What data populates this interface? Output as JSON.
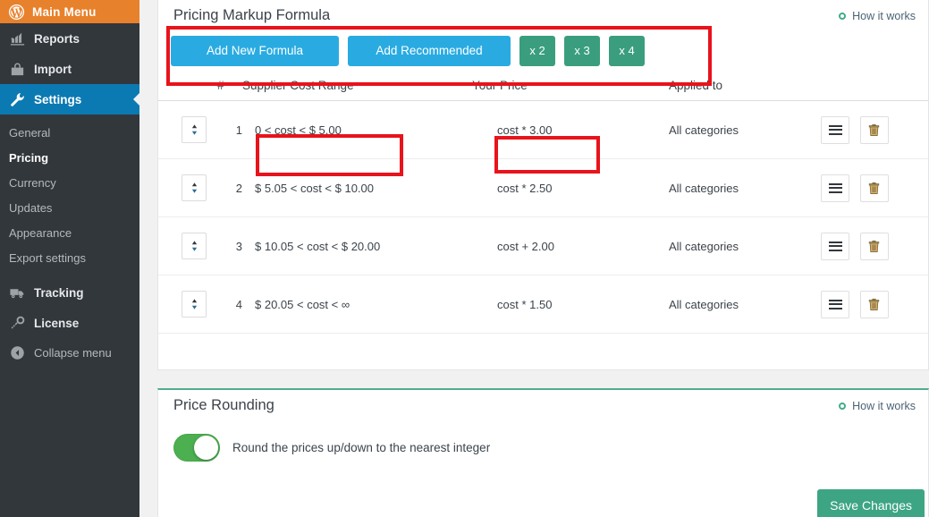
{
  "sidebar": {
    "main_menu": {
      "label": "Main Menu",
      "icon": "wordpress-logo-icon"
    },
    "top_items": [
      {
        "label": "Reports",
        "icon": "chart-icon",
        "active": false
      },
      {
        "label": "Import",
        "icon": "bag-icon",
        "active": false
      },
      {
        "label": "Settings",
        "icon": "wrench-icon",
        "active": true
      }
    ],
    "sub_items": [
      {
        "label": "General",
        "current": false
      },
      {
        "label": "Pricing",
        "current": true
      },
      {
        "label": "Currency",
        "current": false
      },
      {
        "label": "Updates",
        "current": false
      },
      {
        "label": "Appearance",
        "current": false
      },
      {
        "label": "Export settings",
        "current": false
      }
    ],
    "bottom_items": [
      {
        "label": "Tracking",
        "icon": "truck-icon"
      },
      {
        "label": "License",
        "icon": "key-icon"
      }
    ],
    "collapse": {
      "label": "Collapse menu",
      "icon": "collapse-left-arrow-icon"
    },
    "colors": {
      "background": "#32373c",
      "main_menu_background": "#e8812c",
      "active_background": "#0c7ab2"
    }
  },
  "formula_panel": {
    "title": "Pricing Markup Formula",
    "how_it_works": "How it works",
    "toolbar": {
      "add_new_formula": "Add New Formula",
      "add_recommended": "Add Recommended",
      "multipliers": [
        "x 2",
        "x 3",
        "x 4"
      ]
    },
    "table": {
      "headers": [
        "#",
        "Supplier Cost Range",
        "Your Price",
        "Applied to"
      ],
      "rows": [
        {
          "num": "1",
          "range": "0 < cost < $ 5.00",
          "price": "cost * 3.00",
          "applied_to": "All categories"
        },
        {
          "num": "2",
          "range": "$ 5.05 < cost < $ 10.00",
          "price": "cost * 2.50",
          "applied_to": "All categories"
        },
        {
          "num": "3",
          "range": "$ 10.05 < cost < $ 20.00",
          "price": "cost + 2.00",
          "applied_to": "All categories"
        },
        {
          "num": "4",
          "range": "$ 20.05 < cost < ∞",
          "price": "cost * 1.50",
          "applied_to": "All categories"
        }
      ],
      "row_icons": {
        "sort": "sort-updown-icon",
        "menu": "hamburger-icon",
        "delete": "trash-icon"
      }
    }
  },
  "rounding_panel": {
    "title": "Price Rounding",
    "how_it_works": "How it works",
    "toggle_label": "Round the prices up/down to the nearest integer",
    "toggle_on": true,
    "save_label": "Save Changes"
  },
  "annotations": {
    "highlight_color": "#e8131b",
    "boxes": [
      "toolbar-area",
      "row1-supplier-cost-range",
      "row1-your-price"
    ]
  },
  "colors": {
    "primary_blue": "#29abe2",
    "green": "#3a9e7e",
    "save_green": "#3da484",
    "panel_top_border": "#4fae8c",
    "toggle_on": "#4caf50"
  }
}
